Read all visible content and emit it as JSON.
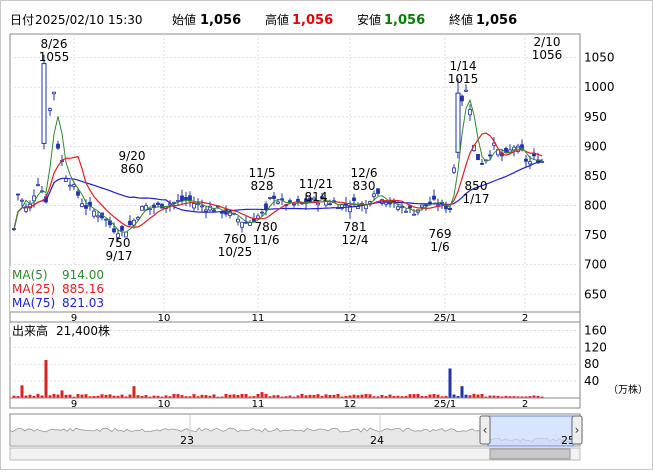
{
  "header": {
    "date_label": "日付",
    "date_value": "2025/02/10 15:30",
    "open_label": "始値",
    "open_value": "1,056",
    "high_label": "高値",
    "high_value": "1,056",
    "low_label": "安値",
    "low_value": "1,056",
    "close_label": "終値",
    "close_value": "1,056",
    "colors": {
      "high": "#e60000",
      "low": "#008000",
      "text": "#000000"
    }
  },
  "price_chart": {
    "y_ticks": [
      "1050",
      "1000",
      "950",
      "900",
      "850",
      "800",
      "750",
      "700",
      "650"
    ],
    "x_ticks": [
      "9",
      "10",
      "11",
      "12",
      "25/1",
      "2"
    ],
    "annotations": [
      {
        "id": "ann-0826",
        "line1": "8/26",
        "line2": "1055"
      },
      {
        "id": "ann-0920",
        "line1": "9/20",
        "line2": "860"
      },
      {
        "id": "ann-0917",
        "line1": "750",
        "line2": "9/17"
      },
      {
        "id": "ann-1105",
        "line1": "11/5",
        "line2": "828"
      },
      {
        "id": "ann-1025",
        "line1": "760",
        "line2": "10/25"
      },
      {
        "id": "ann-1106",
        "line1": "780",
        "line2": "11/6"
      },
      {
        "id": "ann-1121",
        "line1": "11/21",
        "line2": "814"
      },
      {
        "id": "ann-1206",
        "line1": "12/6",
        "line2": "830"
      },
      {
        "id": "ann-1204",
        "line1": "781",
        "line2": "12/4"
      },
      {
        "id": "ann-0106",
        "line1": "769",
        "line2": "1/6"
      },
      {
        "id": "ann-0114",
        "line1": "1/14",
        "line2": "1015"
      },
      {
        "id": "ann-0117",
        "line1": "850",
        "line2": "1/17"
      },
      {
        "id": "ann-0210",
        "line1": "2/10",
        "line2": "1056"
      }
    ],
    "ma_legend": [
      {
        "label": "MA(5)",
        "value": "914.00",
        "color": "#2f8a2f"
      },
      {
        "label": "MA(25)",
        "value": "885.16",
        "color": "#e02020"
      },
      {
        "label": "MA(75)",
        "value": "821.03",
        "color": "#2020d0"
      }
    ]
  },
  "volume_chart": {
    "title": "出来高",
    "value": "21,400株",
    "y_ticks": [
      "160",
      "120",
      "80",
      "40"
    ],
    "unit": "（万株）",
    "x_ticks": [
      "9",
      "10",
      "11",
      "12",
      "25/1",
      "2"
    ],
    "colors": {
      "volume": "#dd2020",
      "volume_alt": "#2233aa"
    }
  },
  "navigator": {
    "labels": [
      "23",
      "24",
      "25"
    ],
    "left_handle": "‹",
    "right_handle": "›"
  },
  "chart_data": {
    "type": "line",
    "title": "",
    "price_ylim": [
      620,
      1090
    ],
    "price_series": [
      {
        "date": "8/26",
        "high": 1055,
        "low": 900,
        "open": 905,
        "close": 1040
      },
      {
        "date": "9/17",
        "high": 780,
        "low": 750,
        "open": 770,
        "close": 760
      },
      {
        "date": "9/20",
        "high": 860,
        "low": 790,
        "open": 795,
        "close": 800
      },
      {
        "date": "10/25",
        "high": 775,
        "low": 760,
        "open": 770,
        "close": 765
      },
      {
        "date": "11/5",
        "high": 828,
        "low": 795,
        "open": 800,
        "close": 815
      },
      {
        "date": "11/6",
        "high": 795,
        "low": 780,
        "open": 790,
        "close": 785
      },
      {
        "date": "11/21",
        "high": 814,
        "low": 795,
        "open": 800,
        "close": 810
      },
      {
        "date": "12/4",
        "high": 790,
        "low": 781,
        "open": 785,
        "close": 788
      },
      {
        "date": "12/6",
        "high": 830,
        "low": 810,
        "open": 815,
        "close": 825
      },
      {
        "date": "1/6",
        "high": 800,
        "low": 769,
        "open": 790,
        "close": 785
      },
      {
        "date": "1/14",
        "high": 1015,
        "low": 880,
        "open": 890,
        "close": 990
      },
      {
        "date": "1/17",
        "high": 900,
        "low": 850,
        "open": 890,
        "close": 860
      },
      {
        "date": "2/10",
        "high": 1056,
        "low": 1056,
        "open": 1056,
        "close": 1056
      }
    ],
    "ma_latest": {
      "MA(5)": 914.0,
      "MA(25)": 885.16,
      "MA(75)": 821.03
    },
    "volume_ylim": [
      0,
      180
    ],
    "volume_unit": "万株",
    "volume_latest": 21400
  }
}
